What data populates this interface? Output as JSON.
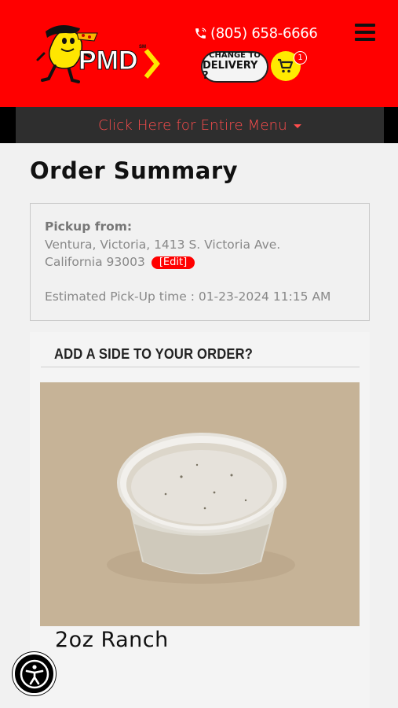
{
  "header": {
    "brand_text": "PMD",
    "brand_mark": "SM",
    "phone": "(805) 658-6666",
    "delivery_line1": "CHANGE TO",
    "delivery_line2": "DELIVERY ?",
    "cart_count": "1",
    "icons": [
      "phone-icon",
      "hamburger-menu-icon",
      "cart-icon"
    ],
    "colors": {
      "brand_red": "#ff0000",
      "cart_yellow": "#ffea00"
    }
  },
  "menu_bar": {
    "label": "Click Here for Entire Menu"
  },
  "order": {
    "title": "Order Summary",
    "pickup_label": "Pickup from:",
    "address_line1": "Ventura, Victoria, 1413 S. Victoria Ave.",
    "address_line2": "California 93003",
    "edit_label": "[Edit]",
    "estimated_label": "Estimated Pick-Up time : 01-23-2024 11:15 AM"
  },
  "side_section": {
    "heading": "ADD A SIDE TO YOUR ORDER?",
    "item_name": "2oz Ranch"
  },
  "accessibility": {
    "icon": "accessibility-icon"
  }
}
